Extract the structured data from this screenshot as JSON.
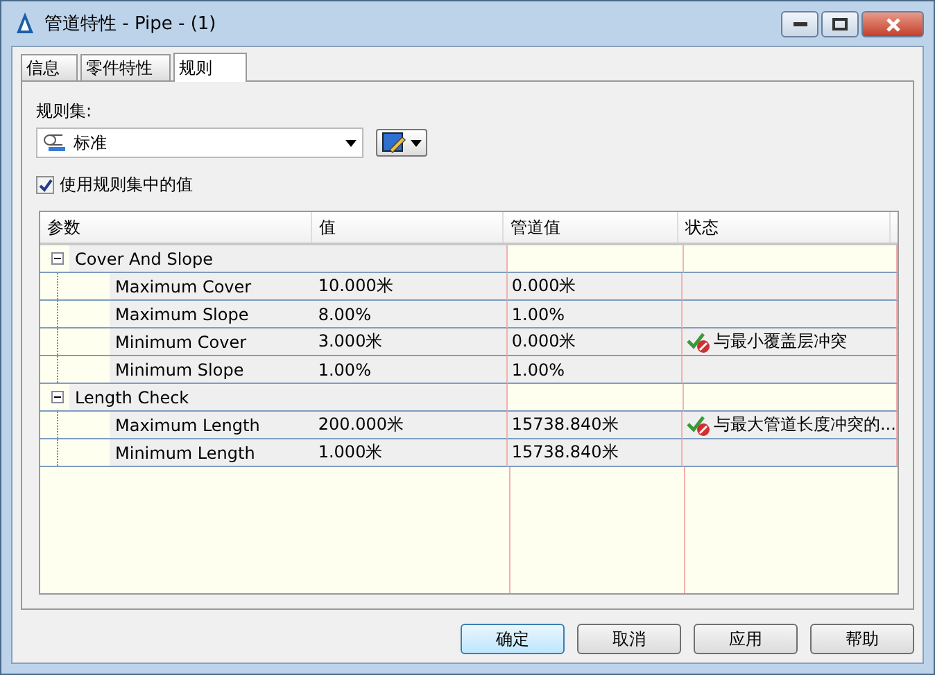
{
  "window": {
    "title": "管道特性 - Pipe - (1)"
  },
  "tabs": [
    {
      "label": "信息",
      "selected": false
    },
    {
      "label": "零件特性",
      "selected": false
    },
    {
      "label": "规则",
      "selected": true
    }
  ],
  "rule_set": {
    "label": "规则集:",
    "value": "标准"
  },
  "use_rule_values": {
    "label": "使用规则集中的值",
    "checked": true
  },
  "table": {
    "columns": [
      "参数",
      "值",
      "管道值",
      "状态"
    ],
    "groups": [
      {
        "name": "Cover And Slope",
        "expanded": true,
        "children": [
          {
            "name": "Maximum Cover",
            "value": "10.000米",
            "pipe_value": "0.000米"
          },
          {
            "name": "Maximum Slope",
            "value": "8.00%",
            "pipe_value": "1.00%"
          },
          {
            "name": "Minimum Cover",
            "value": "3.000米",
            "pipe_value": "0.000米",
            "status": "与最小覆盖层冲突"
          },
          {
            "name": "Minimum Slope",
            "value": "1.00%",
            "pipe_value": "1.00%"
          }
        ]
      },
      {
        "name": "Length Check",
        "expanded": true,
        "children": [
          {
            "name": "Maximum Length",
            "value": "200.000米",
            "pipe_value": "15738.840米",
            "status": "与最大管道长度冲突的..."
          },
          {
            "name": "Minimum Length",
            "value": "1.000米",
            "pipe_value": "15738.840米"
          }
        ]
      }
    ]
  },
  "buttons": [
    {
      "label": "确定",
      "default": true
    },
    {
      "label": "取消",
      "default": false
    },
    {
      "label": "应用",
      "default": false
    },
    {
      "label": "帮助",
      "default": false
    }
  ]
}
